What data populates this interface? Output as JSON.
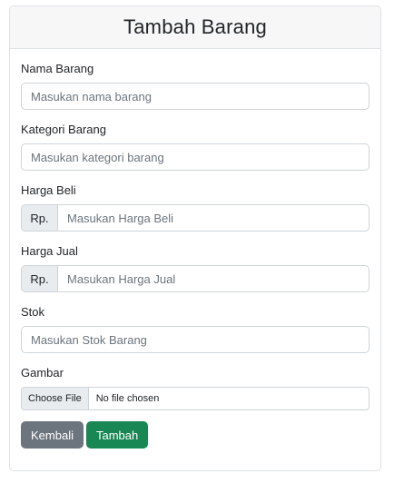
{
  "header": {
    "title": "Tambah Barang"
  },
  "fields": {
    "nama": {
      "label": "Nama Barang",
      "placeholder": "Masukan nama barang"
    },
    "kategori": {
      "label": "Kategori Barang",
      "placeholder": "Masukan kategori barang"
    },
    "harga_beli": {
      "label": "Harga Beli",
      "prefix": "Rp.",
      "placeholder": "Masukan Harga Beli"
    },
    "harga_jual": {
      "label": "Harga Jual",
      "prefix": "Rp.",
      "placeholder": "Masukan Harga Jual"
    },
    "stok": {
      "label": "Stok",
      "placeholder": "Masukan Stok Barang"
    },
    "gambar": {
      "label": "Gambar",
      "button": "Choose File",
      "status": "No file chosen"
    }
  },
  "actions": {
    "back_label": "Kembali",
    "add_label": "Tambah"
  },
  "colors": {
    "back": "#6c757d",
    "add": "#198754",
    "header_bg": "#f7f7f7",
    "border": "#ced4da"
  }
}
